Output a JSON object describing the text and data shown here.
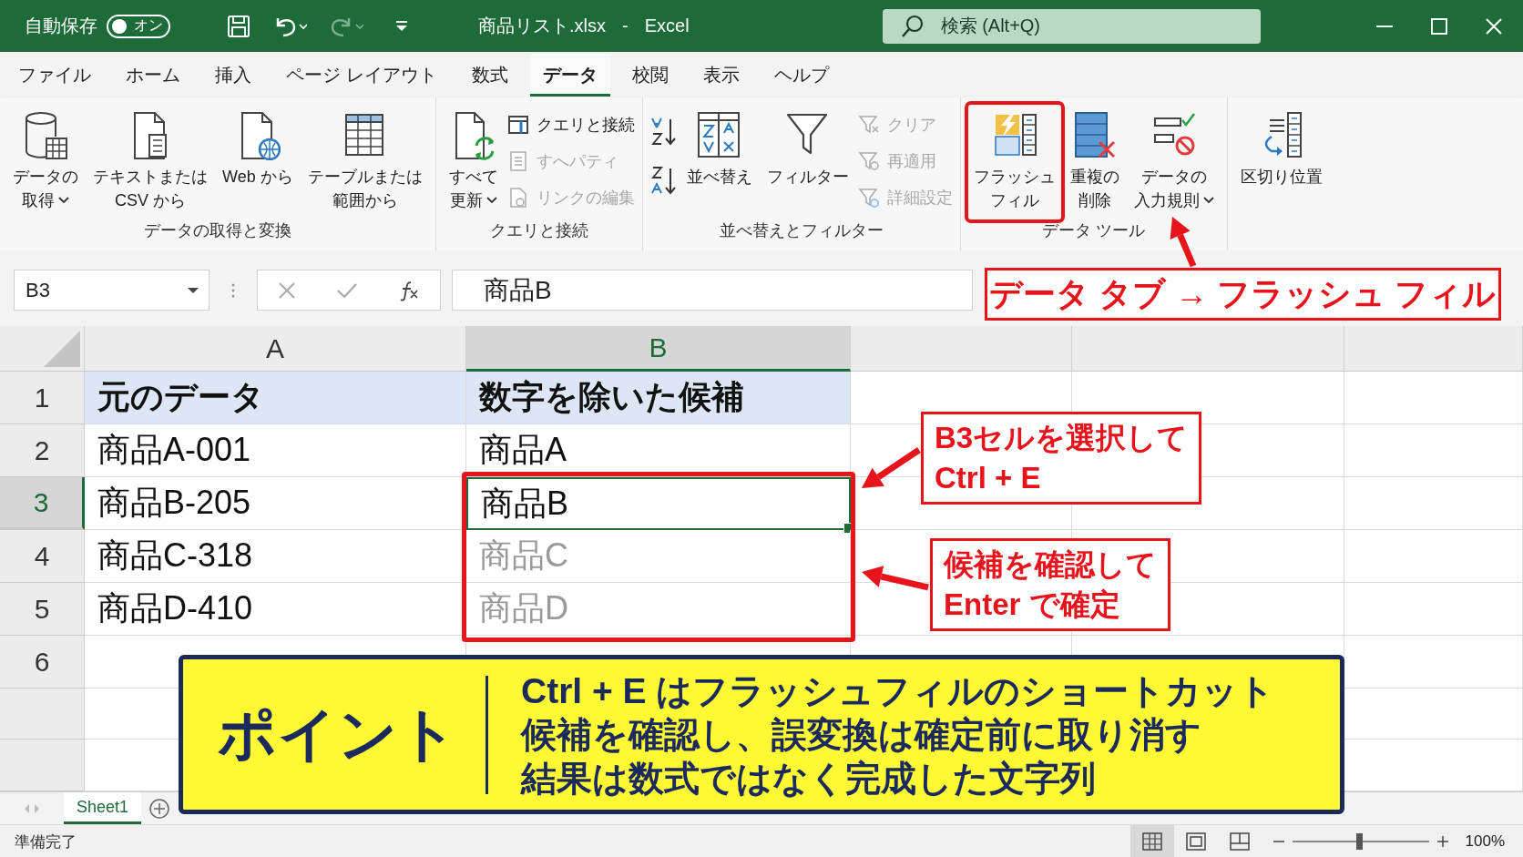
{
  "title_bar": {
    "autosave_label": "自動保存",
    "autosave_toggle": {
      "label": "オン"
    },
    "filename": "商品リスト.xlsx",
    "separator": "-",
    "app": "Excel",
    "search": {
      "placeholder": "検索 (Alt+Q)"
    }
  },
  "tabs": [
    {
      "label": "ファイル",
      "selected": false
    },
    {
      "label": "ホーム",
      "selected": false
    },
    {
      "label": "挿入",
      "selected": false
    },
    {
      "label": "ページ レイアウト",
      "selected": false
    },
    {
      "label": "数式",
      "selected": false
    },
    {
      "label": "データ",
      "selected": true
    },
    {
      "label": "校閲",
      "selected": false
    },
    {
      "label": "表示",
      "selected": false
    },
    {
      "label": "ヘルプ",
      "selected": false
    }
  ],
  "ribbon": {
    "groups": [
      {
        "label": "データの取得と変換",
        "items": [
          {
            "kind": "large",
            "lines": [
              "データの",
              "取得"
            ],
            "dropdown": true
          },
          {
            "kind": "large",
            "lines": [
              "テキストまたは",
              "CSV から"
            ],
            "dropdown": false
          },
          {
            "kind": "large",
            "lines": [
              "Web から"
            ],
            "dropdown": false
          },
          {
            "kind": "large",
            "lines": [
              "テーブルまたは",
              "範囲から"
            ],
            "dropdown": false
          }
        ]
      },
      {
        "label": "クエリと接続",
        "items": [
          {
            "kind": "large",
            "lines": [
              "すべて",
              "更新"
            ],
            "dropdown": true
          },
          {
            "kind": "stack",
            "items": [
              {
                "label": "クエリと接続",
                "disabled": false
              },
              {
                "label": "すへパティ",
                "disabled": true
              },
              {
                "label": "リンクの編集",
                "disabled": true
              }
            ]
          }
        ]
      },
      {
        "label": "並べ替えとフィルター",
        "items": [
          {
            "kind": "sort"
          },
          {
            "kind": "large",
            "lines": [
              "並べ替え"
            ],
            "dropdown": false
          },
          {
            "kind": "large",
            "lines": [
              "フィルター"
            ],
            "dropdown": false
          },
          {
            "kind": "stack",
            "items": [
              {
                "label": "クリア",
                "disabled": true
              },
              {
                "label": "再適用",
                "disabled": true
              },
              {
                "label": "詳細設定",
                "disabled": true
              }
            ]
          }
        ]
      },
      {
        "label": "データ ツール",
        "items": [
          {
            "kind": "large",
            "lines": [
              "フラッシュ",
              "フィル"
            ],
            "dropdown": false,
            "highlighted": true
          },
          {
            "kind": "large",
            "lines": [
              "重複の",
              "削除"
            ],
            "dropdown": false
          },
          {
            "kind": "large",
            "lines": [
              "データの",
              "入力規則"
            ],
            "dropdown": true
          }
        ]
      },
      {
        "items": [
          {
            "kind": "large",
            "lines": [
              "区切り位置"
            ],
            "dropdown": false
          }
        ]
      }
    ]
  },
  "formula_bar": {
    "name_box": "B3",
    "formula": "商品B"
  },
  "sheet": {
    "columns": [
      {
        "label": "A",
        "selected": false
      },
      {
        "label": "B",
        "selected": true
      }
    ],
    "rows": [
      {
        "number": "1",
        "kind": "header",
        "selected": false,
        "cells": [
          {
            "text": "元のデータ",
            "selected": false
          },
          {
            "text": "数字を除いた候補",
            "selected": false
          }
        ]
      },
      {
        "number": "2",
        "kind": "data",
        "selected": false,
        "cells": [
          {
            "text": "商品A-001",
            "selected": false
          },
          {
            "text": "商品A",
            "selected": false,
            "suggested": false
          }
        ]
      },
      {
        "number": "3",
        "kind": "data",
        "selected": true,
        "cells": [
          {
            "text": "商品B-205",
            "selected": false
          },
          {
            "text": "商品B",
            "selected": true,
            "suggested": false
          }
        ]
      },
      {
        "number": "4",
        "kind": "data",
        "selected": false,
        "cells": [
          {
            "text": "商品C-318",
            "selected": false
          },
          {
            "text": "商品C",
            "selected": false,
            "suggested": true
          }
        ]
      },
      {
        "number": "5",
        "kind": "data",
        "selected": false,
        "cells": [
          {
            "text": "商品D-410",
            "selected": false
          },
          {
            "text": "商品D",
            "selected": false,
            "suggested": true
          }
        ]
      },
      {
        "number": "6",
        "kind": "data",
        "selected": false,
        "cells": []
      }
    ]
  },
  "sheet_tabs": [
    {
      "label": "Sheet1",
      "selected": true
    }
  ],
  "status_bar": {
    "status": "準備完了",
    "views": [
      {
        "selected": true
      },
      {
        "selected": false
      },
      {
        "selected": false
      }
    ],
    "zoom": {
      "level": 0.49,
      "reading": "100%"
    }
  },
  "annotations": {
    "ribbon_label": "データ タブ → フラッシュ フィル",
    "callouts": [
      {
        "lines": [
          "B3セルを選択して",
          "Ctrl + E"
        ]
      },
      {
        "lines": [
          "候補を確認して",
          "Enter で確定"
        ]
      }
    ],
    "point": {
      "title": "ポイント",
      "lines": [
        "Ctrl + E はフラッシュフィルのショートカット",
        "候補を確認し、誤変換は確定前に取り消す",
        "結果は数式ではなく完成した文字列"
      ]
    }
  }
}
